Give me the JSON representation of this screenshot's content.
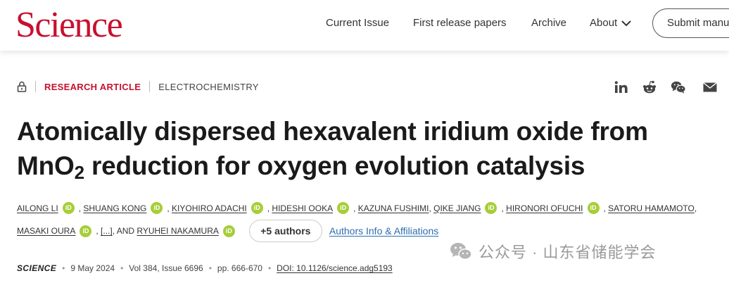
{
  "header": {
    "logo": "Science",
    "nav": [
      {
        "label": "Current Issue"
      },
      {
        "label": "First release papers"
      },
      {
        "label": "Archive"
      },
      {
        "label": "About"
      }
    ],
    "submit_label": "Submit manuscript"
  },
  "article": {
    "type": "RESEARCH ARTICLE",
    "subject": "ELECTROCHEMISTRY",
    "title_part1": "Atomically dispersed hexavalent iridium oxide from",
    "title_part2a": "MnO",
    "title_sub": "2",
    "title_part2b": " reduction for oxygen evolution catalysis"
  },
  "share_icons": [
    "linkedin-icon",
    "reddit-icon",
    "wechat-icon",
    "email-icon"
  ],
  "authors": {
    "list": [
      "AILONG LI",
      "SHUANG KONG",
      "KIYOHIRO ADACHI",
      "HIDESHI OOKA",
      "KAZUNA FUSHIMI",
      "QIKE JIANG",
      "HIRONORI OFUCHI",
      "SATORU HAMAMOTO",
      "MASAKI OURA",
      "RYUHEI NAKAMURA"
    ],
    "orcid_label": "iD",
    "ellipsis": "[...]",
    "and_label": ", AND",
    "more_label": "+5 authors",
    "affiliations_label": "Authors Info & Affiliations"
  },
  "citation": {
    "journal": "SCIENCE",
    "date": "9 May 2024",
    "volume": "Vol 384, Issue 6696",
    "pages": "pp. 666-670",
    "doi": "DOI: 10.1126/science.adg5193"
  },
  "watermark": {
    "text": "公众号 · 山东省储能学会"
  },
  "colors": {
    "brand": "#c8102e",
    "orcid": "#a6ce39",
    "link": "#2b6cb0"
  }
}
